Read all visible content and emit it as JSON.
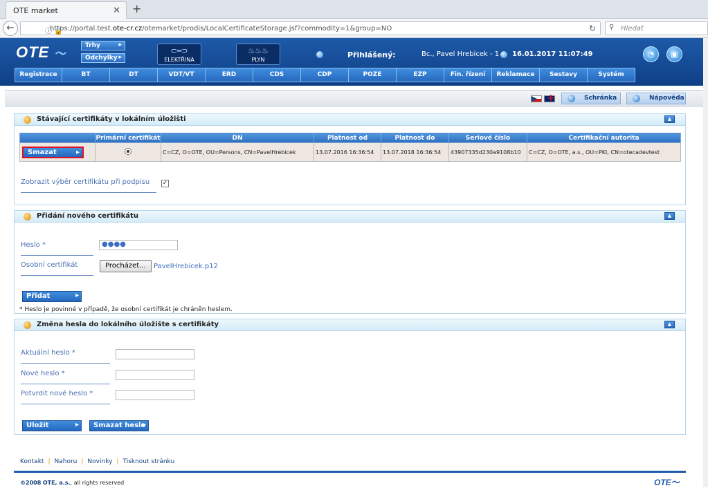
{
  "browser": {
    "tab_title": "OTE market",
    "url_prefix": "https://portal.test.",
    "url_host": "ote-cr.cz",
    "url_path": "/otemarket/prodis/LocalCertificateStorage.jsf?commodity=1&group=NO",
    "search_placeholder": "Hledat"
  },
  "header": {
    "logo": "OTE",
    "pills": [
      "Trhy",
      "Odchylky"
    ],
    "elektrina_label": "ELEKTŘINA",
    "plyn_label": "PLYN",
    "logged_label": "Přihlášený:",
    "user": "Bc., Pavel Hrebicek - 1",
    "datetime": "16.01.2017 11:07:49"
  },
  "menu": [
    "Registrace",
    "BT",
    "DT",
    "VDT/VT",
    "ERD",
    "CDS",
    "CDP",
    "POZE",
    "EZP",
    "Fin. řízení",
    "Reklamace",
    "Sestavy",
    "Systém"
  ],
  "toolbar": {
    "schranka": "Schránka",
    "napoveda": "Nápověda"
  },
  "panel1": {
    "title": "Stávající certifikáty v lokálním úložišti",
    "columns": [
      "",
      "Primární certifikát",
      "DN",
      "Platnost od",
      "Platnost do",
      "Seriové číslo",
      "Certifikační autorita"
    ],
    "row": {
      "delete_label": "Smazat",
      "dn": "C=CZ, O=OTE, OU=Persons, CN=PavelHrebicek",
      "valid_from": "13.07.2016 16:36:54",
      "valid_to": "13.07.2018 16:36:54",
      "serial": "43907335d230a9108b10",
      "authority": "C=CZ, O=OTE, a.s., OU=PKI, CN=otecadevtest"
    },
    "show_selection_label": "Zobrazit výběr certifikátu při podpisu",
    "show_selection_checked": "✓"
  },
  "panel2": {
    "title": "Přidání nového certifikátu",
    "password_label": "Heslo *",
    "password_value": "●●●●",
    "cert_label": "Osobní certifikát",
    "browse_label": "Procházet...",
    "file_name": "PavelHrebicek.p12",
    "add_label": "Přidat",
    "note": "* Heslo je povinné v případě, že osobní certifikát je chráněn heslem."
  },
  "panel3": {
    "title": "Změna hesla do lokálního úložište s certifikáty",
    "current_label": "Aktuální heslo *",
    "new_label": "Nové heslo *",
    "confirm_label": "Potvrdit nové heslo *",
    "save_label": "Uložit",
    "delete_password_label": "Smazat heslo"
  },
  "footer": {
    "links": [
      "Kontakt",
      "Nahoru",
      "Novinky",
      "Tisknout stránku"
    ],
    "copyright_year": "©2008",
    "copyright_org": "OTE, a.s.",
    "copyright_rest": ", all rights reserved",
    "logo": "OTE"
  }
}
